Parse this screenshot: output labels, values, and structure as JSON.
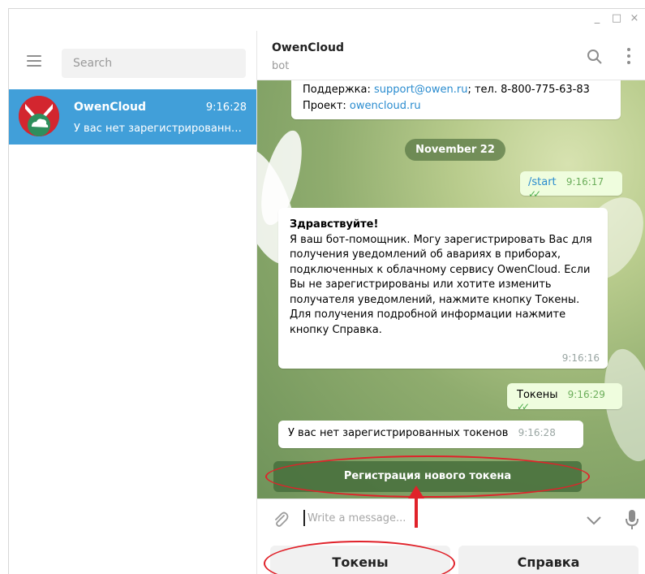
{
  "window": {
    "controls": [
      "_",
      "□",
      "×"
    ]
  },
  "sidebar": {
    "search_placeholder": "Search",
    "chats": [
      {
        "name": "OwenCloud",
        "time": "9:16:28",
        "preview": "У вас нет зарегистрированных токенов"
      }
    ]
  },
  "chat": {
    "title": "OwenCloud",
    "status": "bot",
    "messages": {
      "top_support_label": "Поддержка: ",
      "top_support_email": "support@owen.ru",
      "top_support_phone": "; тел. 8-800-775-63-83",
      "top_project_label": "Проект: ",
      "top_project_link": "owencloud.ru",
      "date_separator": "November 22",
      "start_text": "/start",
      "start_time": "9:16:17",
      "welcome_title": "Здравствуйте!",
      "welcome_body": "Я ваш бот-помощник. Могу зарегистрировать Вас для получения уведомлений об авариях в приборах, подключенных к облачному сервису OwenCloud. Если Вы не зарегистрированы или хотите изменить получателя уведомлений, нажмите кнопку Токены. Для получения подробной информации нажмите кнопку Справка.",
      "welcome_time": "9:16:16",
      "tokens_text": "Токены",
      "tokens_time": "9:16:29",
      "no_tokens_text": "У вас нет зарегистрированных токенов",
      "no_tokens_time": "9:16:28"
    },
    "inline_button": "Регистрация нового токена",
    "composer_placeholder": "Write a message...",
    "keyboard": [
      "Токены",
      "Справка"
    ]
  },
  "colors": {
    "accent": "#419fd9",
    "highlight": "#e0222a",
    "outgoing": "#effdde"
  }
}
